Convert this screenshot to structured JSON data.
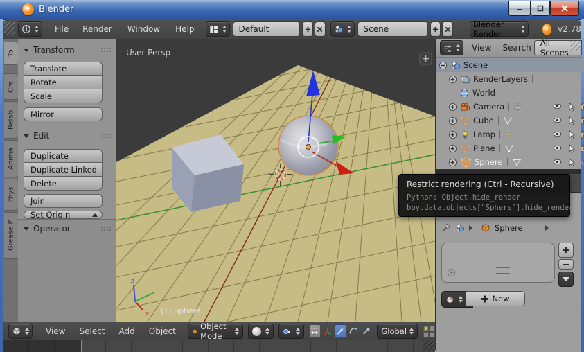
{
  "window": {
    "title": "Blender",
    "controls": {
      "minimize": "minimize",
      "maximize": "maximize",
      "close": "close"
    }
  },
  "topbar": {
    "menus": [
      "File",
      "Render",
      "Window",
      "Help"
    ],
    "layout_value": "Default",
    "scene_value": "Scene",
    "engine_value": "Blender Render",
    "version": "v2.78"
  },
  "toolshelf": {
    "tabs": [
      "To",
      "Cre",
      "Relati",
      "Anima",
      "Phys",
      "Grease P"
    ],
    "transform": {
      "title": "Transform",
      "group": [
        "Translate",
        "Rotate",
        "Scale"
      ],
      "mirror": "Mirror"
    },
    "edit": {
      "title": "Edit",
      "group": [
        "Duplicate",
        "Duplicate Linked",
        "Delete"
      ],
      "join": "Join",
      "set_origin": "Set Origin"
    },
    "operator": {
      "title": "Operator"
    }
  },
  "viewport": {
    "view_label": "User Persp",
    "object_label": "(1) Sphere",
    "axis_z": "z",
    "axis_x": "x"
  },
  "vp_header": {
    "menus": [
      "View",
      "Select",
      "Add",
      "Object"
    ],
    "mode": "Object Mode",
    "orientation": "Global"
  },
  "outliner": {
    "view": "View",
    "search": "Search",
    "all_scenes": "All Scenes",
    "items": [
      {
        "label": "Scene",
        "icon": "scene-icon",
        "expanded": true,
        "selected": true
      },
      {
        "label": "RenderLayers",
        "icon": "renderlayers-icon"
      },
      {
        "label": "World",
        "icon": "world-icon"
      },
      {
        "label": "Camera",
        "icon": "camera-object-icon",
        "restricts": true
      },
      {
        "label": "Cube",
        "icon": "mesh-icon",
        "restricts": true
      },
      {
        "label": "Lamp",
        "icon": "lamp-icon",
        "restricts": true
      },
      {
        "label": "Plane",
        "icon": "mesh-icon",
        "restricts": true
      },
      {
        "label": "Sphere",
        "icon": "mesh-icon",
        "restricts": true,
        "active": true,
        "render_restrict_hovered": true
      }
    ]
  },
  "tooltip": {
    "title": "Restrict rendering (Ctrl - Recursive)",
    "python_label": "Python: Object.hide_render",
    "python_code": "bpy.data.objects[\"Sphere\"].hide_render"
  },
  "properties": {
    "object_name": "Sphere",
    "new_label": "New"
  },
  "colors": {
    "titlebar_blue": "#3a68b4",
    "header_gray": "#454545",
    "panel_gray": "#9e9e9e",
    "viewport_bg": "#3b3b3b",
    "ground": "#c8bc86",
    "selection_orange": "#e8903a",
    "active_tool_blue": "#4f76b8",
    "axis_x_red": "#b03324",
    "axis_y_green": "#3f8f35",
    "axis_z_blue": "#3a55d0",
    "frame_marker_green": "#6fae3c"
  }
}
